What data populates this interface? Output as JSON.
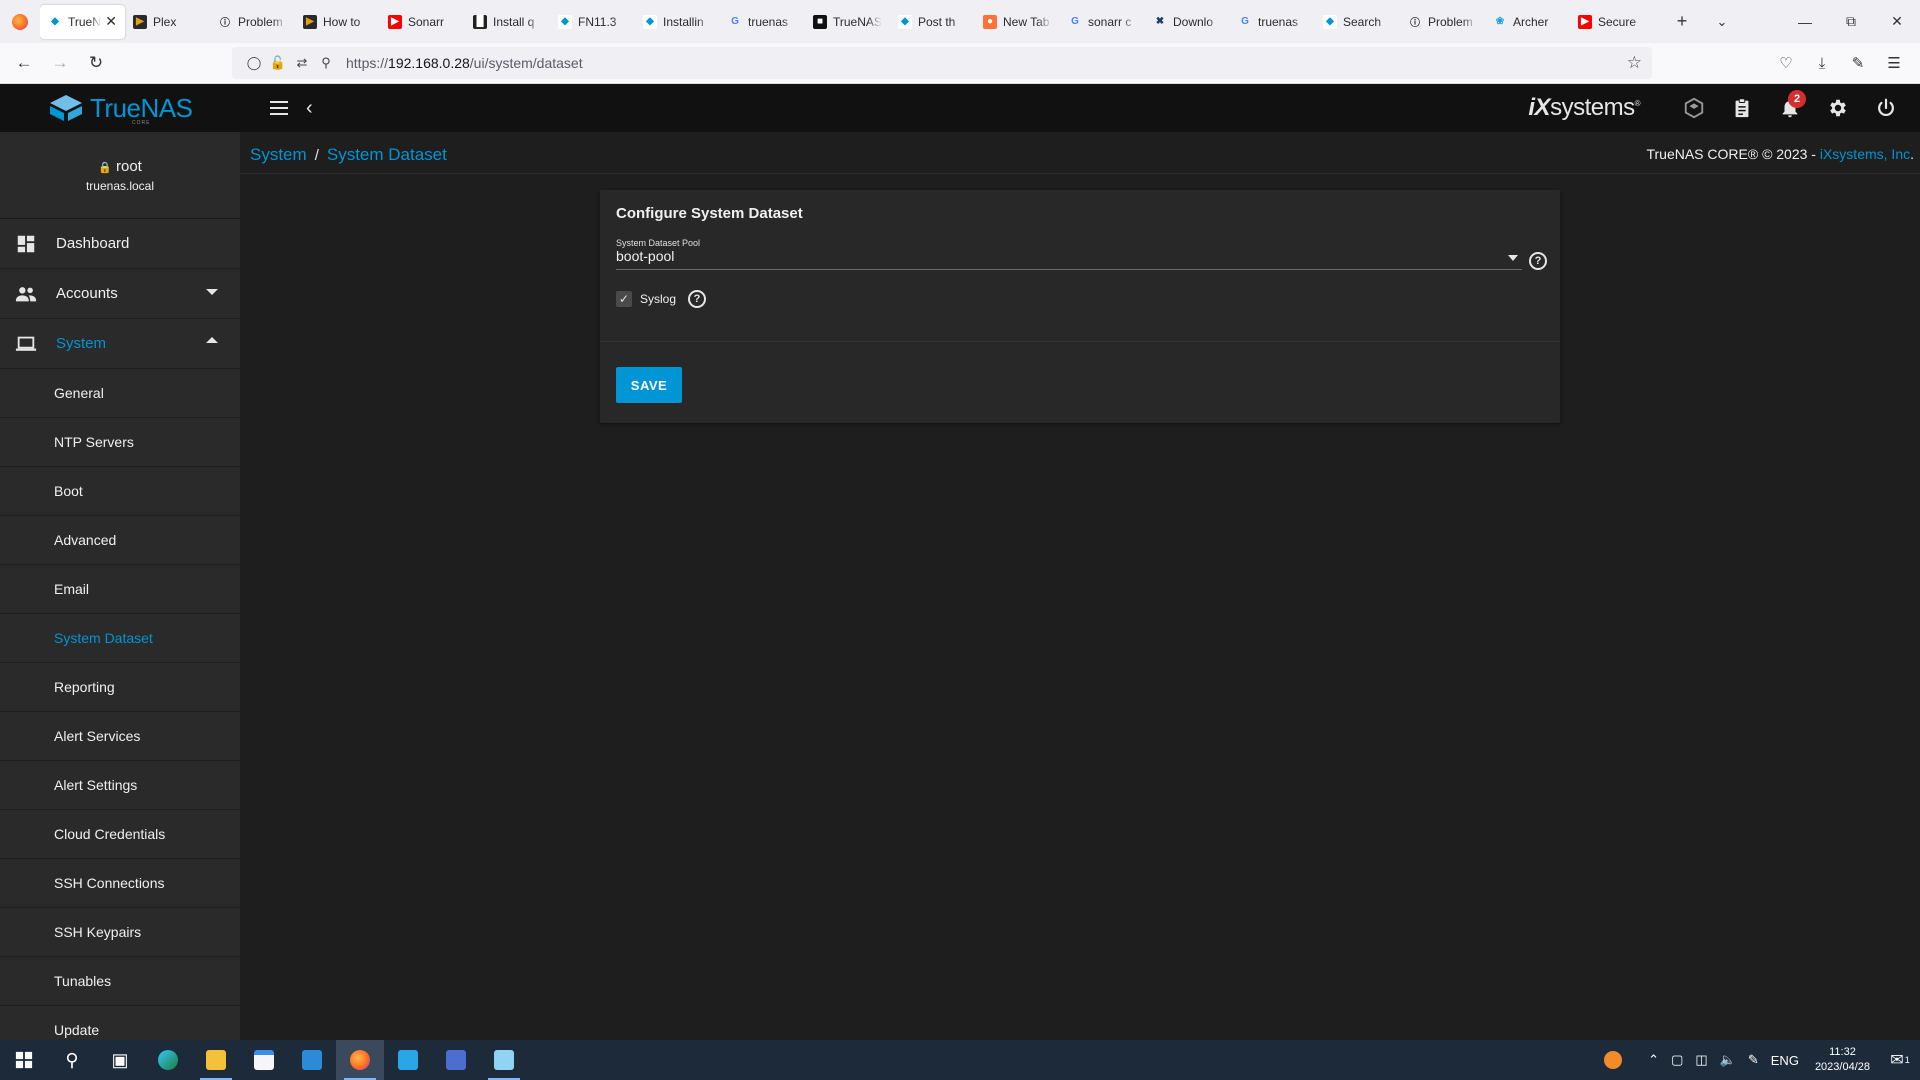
{
  "browser": {
    "tabs": [
      {
        "title": "TrueNAS",
        "fav": "truenas-favicon",
        "active": true
      },
      {
        "title": "Plex",
        "fav": "plex-favicon"
      },
      {
        "title": "Problem",
        "fav": "info-favicon"
      },
      {
        "title": "How to",
        "fav": "plex-favicon"
      },
      {
        "title": "Sonarr",
        "fav": "youtube-favicon"
      },
      {
        "title": "Install q",
        "fav": "install-favicon"
      },
      {
        "title": "FN11.3",
        "fav": "truenas-favicon"
      },
      {
        "title": "Installin",
        "fav": "truenas-favicon"
      },
      {
        "title": "truenas",
        "fav": "google-favicon"
      },
      {
        "title": "TrueNAS",
        "fav": "dark-favicon"
      },
      {
        "title": "Post th",
        "fav": "truenas-favicon"
      },
      {
        "title": "New Tab",
        "fav": "firefox-favicon"
      },
      {
        "title": "sonarr c",
        "fav": "google-favicon"
      },
      {
        "title": "Downlo",
        "fav": "download-favicon"
      },
      {
        "title": "truenas",
        "fav": "google-favicon"
      },
      {
        "title": "Search",
        "fav": "truenas-favicon"
      },
      {
        "title": "Problem",
        "fav": "info-favicon"
      },
      {
        "title": "Archer",
        "fav": "archer-favicon"
      },
      {
        "title": "Secure",
        "fav": "youtube-favicon"
      }
    ],
    "url_prefix": "https://",
    "url_host": "192.168.0.28",
    "url_path": "/ui/system/dataset"
  },
  "app": {
    "brand": "TrueNAS",
    "brand_sub": "CORE",
    "vendor_logo_i": "iX",
    "vendor_logo_rest": "systems",
    "notification_count": "2"
  },
  "user": {
    "name": "root",
    "host": "truenas.local"
  },
  "sidebar": {
    "dashboard": "Dashboard",
    "accounts": "Accounts",
    "system": "System",
    "sub_items": [
      "General",
      "NTP Servers",
      "Boot",
      "Advanced",
      "Email",
      "System Dataset",
      "Reporting",
      "Alert Services",
      "Alert Settings",
      "Cloud Credentials",
      "SSH Connections",
      "SSH Keypairs",
      "Tunables",
      "Update"
    ],
    "active_sub": "System Dataset"
  },
  "breadcrumb": {
    "parent": "System",
    "current": "System Dataset"
  },
  "copyright": {
    "text": "TrueNAS CORE® © 2023 - ",
    "link": "iXsystems, Inc",
    "end": "."
  },
  "form": {
    "title": "Configure System Dataset",
    "pool_label": "System Dataset Pool",
    "pool_value": "boot-pool",
    "syslog_label": "Syslog",
    "syslog_checked": true,
    "save_label": "SAVE"
  },
  "taskbar": {
    "lang": "ENG",
    "time": "11:32",
    "date": "2023/04/28",
    "notif_count": "1"
  },
  "colors": {
    "accent": "#0095d5",
    "header_bg": "#111111",
    "sidebar_bg": "#2a2a2a",
    "content_bg": "#1e1e1e",
    "card_bg": "#282828"
  }
}
